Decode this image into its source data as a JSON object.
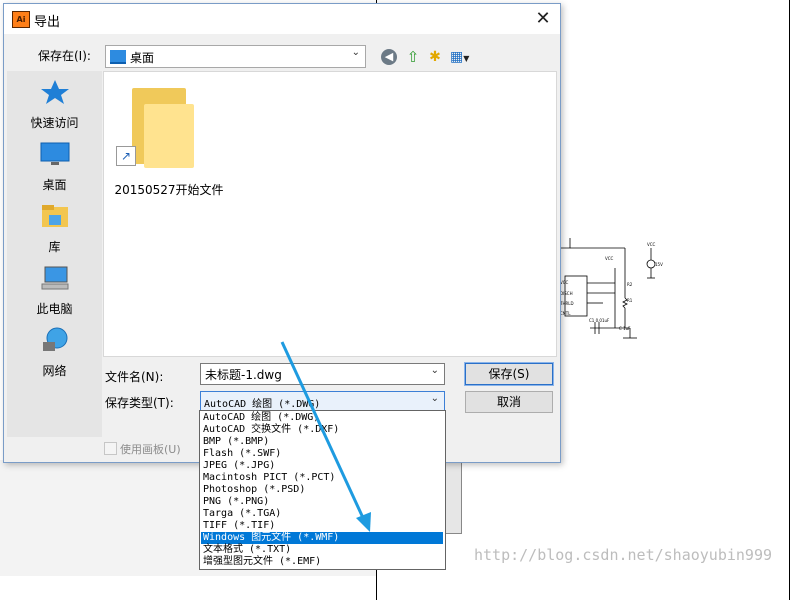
{
  "dialog": {
    "title": "导出",
    "app_icon_text": "Ai",
    "close_glyph": "✕"
  },
  "save_in": {
    "label": "保存在(I):",
    "value": "桌面"
  },
  "places": [
    {
      "label": "快速访问",
      "icon": "star-icon"
    },
    {
      "label": "桌面",
      "icon": "desktop-icon"
    },
    {
      "label": "库",
      "icon": "library-icon"
    },
    {
      "label": "此电脑",
      "icon": "computer-icon"
    },
    {
      "label": "网络",
      "icon": "network-icon"
    }
  ],
  "files": [
    {
      "name": "20150527开始文件",
      "type": "folder-shortcut"
    }
  ],
  "filename": {
    "label": "文件名(N):",
    "value": "未标题-1.dwg"
  },
  "filetype": {
    "label": "保存类型(T):",
    "value": "AutoCAD 绘图 (*.DWG)",
    "options": [
      "AutoCAD 绘图 (*.DWG)",
      "AutoCAD 交换文件 (*.DXF)",
      "BMP (*.BMP)",
      "Flash (*.SWF)",
      "JPEG (*.JPG)",
      "Macintosh PICT (*.PCT)",
      "Photoshop (*.PSD)",
      "PNG (*.PNG)",
      "Targa (*.TGA)",
      "TIFF (*.TIF)",
      "Windows 图元文件 (*.WMF)",
      "文本格式 (*.TXT)",
      "增强型图元文件 (*.EMF)"
    ],
    "highlighted": "Windows 图元文件 (*.WMF)"
  },
  "buttons": {
    "save": "保存(S)",
    "cancel": "取消"
  },
  "artboard_checkbox": {
    "label": "使用画板(U)",
    "checked": false
  },
  "watermark": "http://blog.csdn.net/shaoyubin999",
  "colors": {
    "selection": "#0078d7",
    "annotation_arrow": "#1e9be0",
    "folder": "#ffe38f"
  }
}
